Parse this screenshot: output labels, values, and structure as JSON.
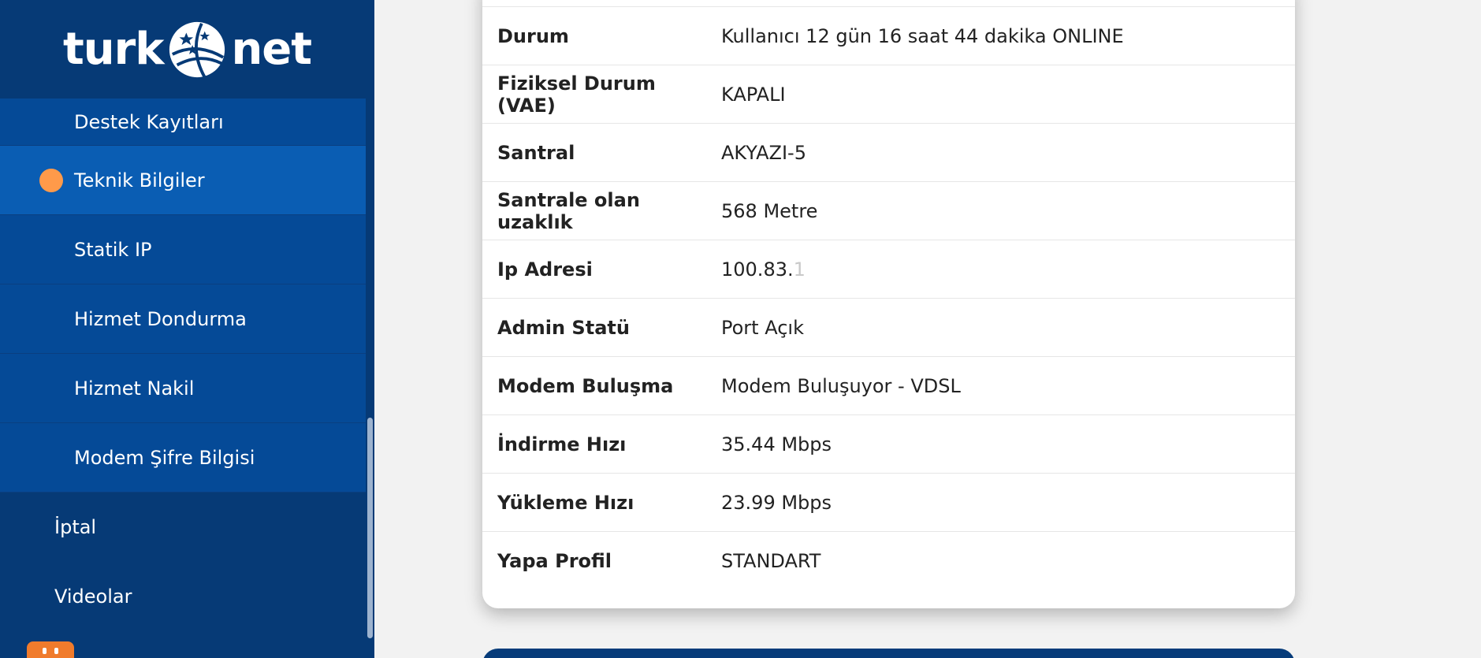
{
  "brand": {
    "left": "turk",
    "right": "net",
    "accent_color": "#ff9a4a"
  },
  "sidebar": {
    "submenu": [
      {
        "label": "Destek Kayıtları",
        "active": false
      },
      {
        "label": "Teknik Bilgiler",
        "active": true
      },
      {
        "label": "Statik IP",
        "active": false
      },
      {
        "label": "Hizmet Dondurma",
        "active": false
      },
      {
        "label": "Hizmet Nakil",
        "active": false
      },
      {
        "label": "Modem Şifre Bilgisi",
        "active": false
      }
    ],
    "main_items": [
      {
        "label": "İptal"
      },
      {
        "label": "Videolar"
      }
    ]
  },
  "technical_info": {
    "rows": [
      {
        "label": "Durum",
        "value": "Kullanıcı 12 gün 16 saat 44 dakika ONLINE"
      },
      {
        "label": "Fiziksel Durum (VAE)",
        "value": "KAPALI"
      },
      {
        "label": "Santral",
        "value": "AKYAZI-5"
      },
      {
        "label": "Santrale olan uzaklık",
        "value": "568 Metre"
      },
      {
        "label": "Ip Adresi",
        "value": "100.83.",
        "value_masked": "1"
      },
      {
        "label": "Admin Statü",
        "value": "Port Açık"
      },
      {
        "label": "Modem Buluşma",
        "value": "Modem Buluşuyor - VDSL"
      },
      {
        "label": "İndirme Hızı",
        "value": "35.44 Mbps"
      },
      {
        "label": "Yükleme Hızı",
        "value": "23.99 Mbps"
      },
      {
        "label": "Yapa Profil",
        "value": "STANDART"
      }
    ]
  }
}
